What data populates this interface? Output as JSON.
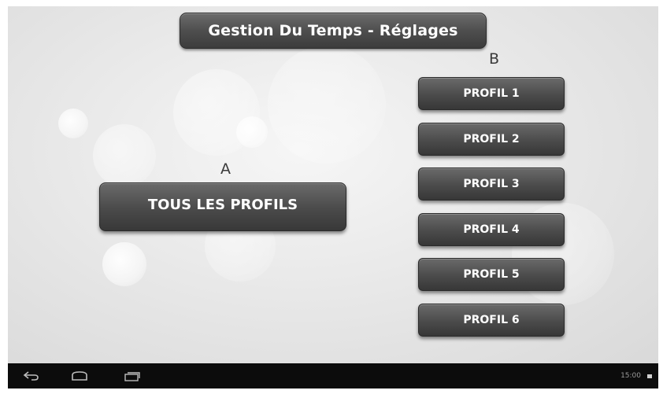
{
  "header": {
    "title": "Gestion Du Temps - Réglages"
  },
  "section_a": {
    "letter": "A",
    "button_label": "TOUS LES PROFILS"
  },
  "section_b": {
    "letter": "B",
    "profiles": [
      {
        "label": "PROFIL 1"
      },
      {
        "label": "PROFIL 2"
      },
      {
        "label": "PROFIL 3"
      },
      {
        "label": "PROFIL 4"
      },
      {
        "label": "PROFIL 5"
      },
      {
        "label": "PROFIL 6"
      }
    ]
  },
  "navbar": {
    "icons": [
      "back-icon",
      "home-icon",
      "recent-apps-icon"
    ],
    "time": "15:00",
    "status_icon": "battery-icon"
  },
  "colors": {
    "button_dark": "#454545",
    "navbar_bg": "#0c0c0c",
    "screen_bg": "#e6e6e6"
  }
}
